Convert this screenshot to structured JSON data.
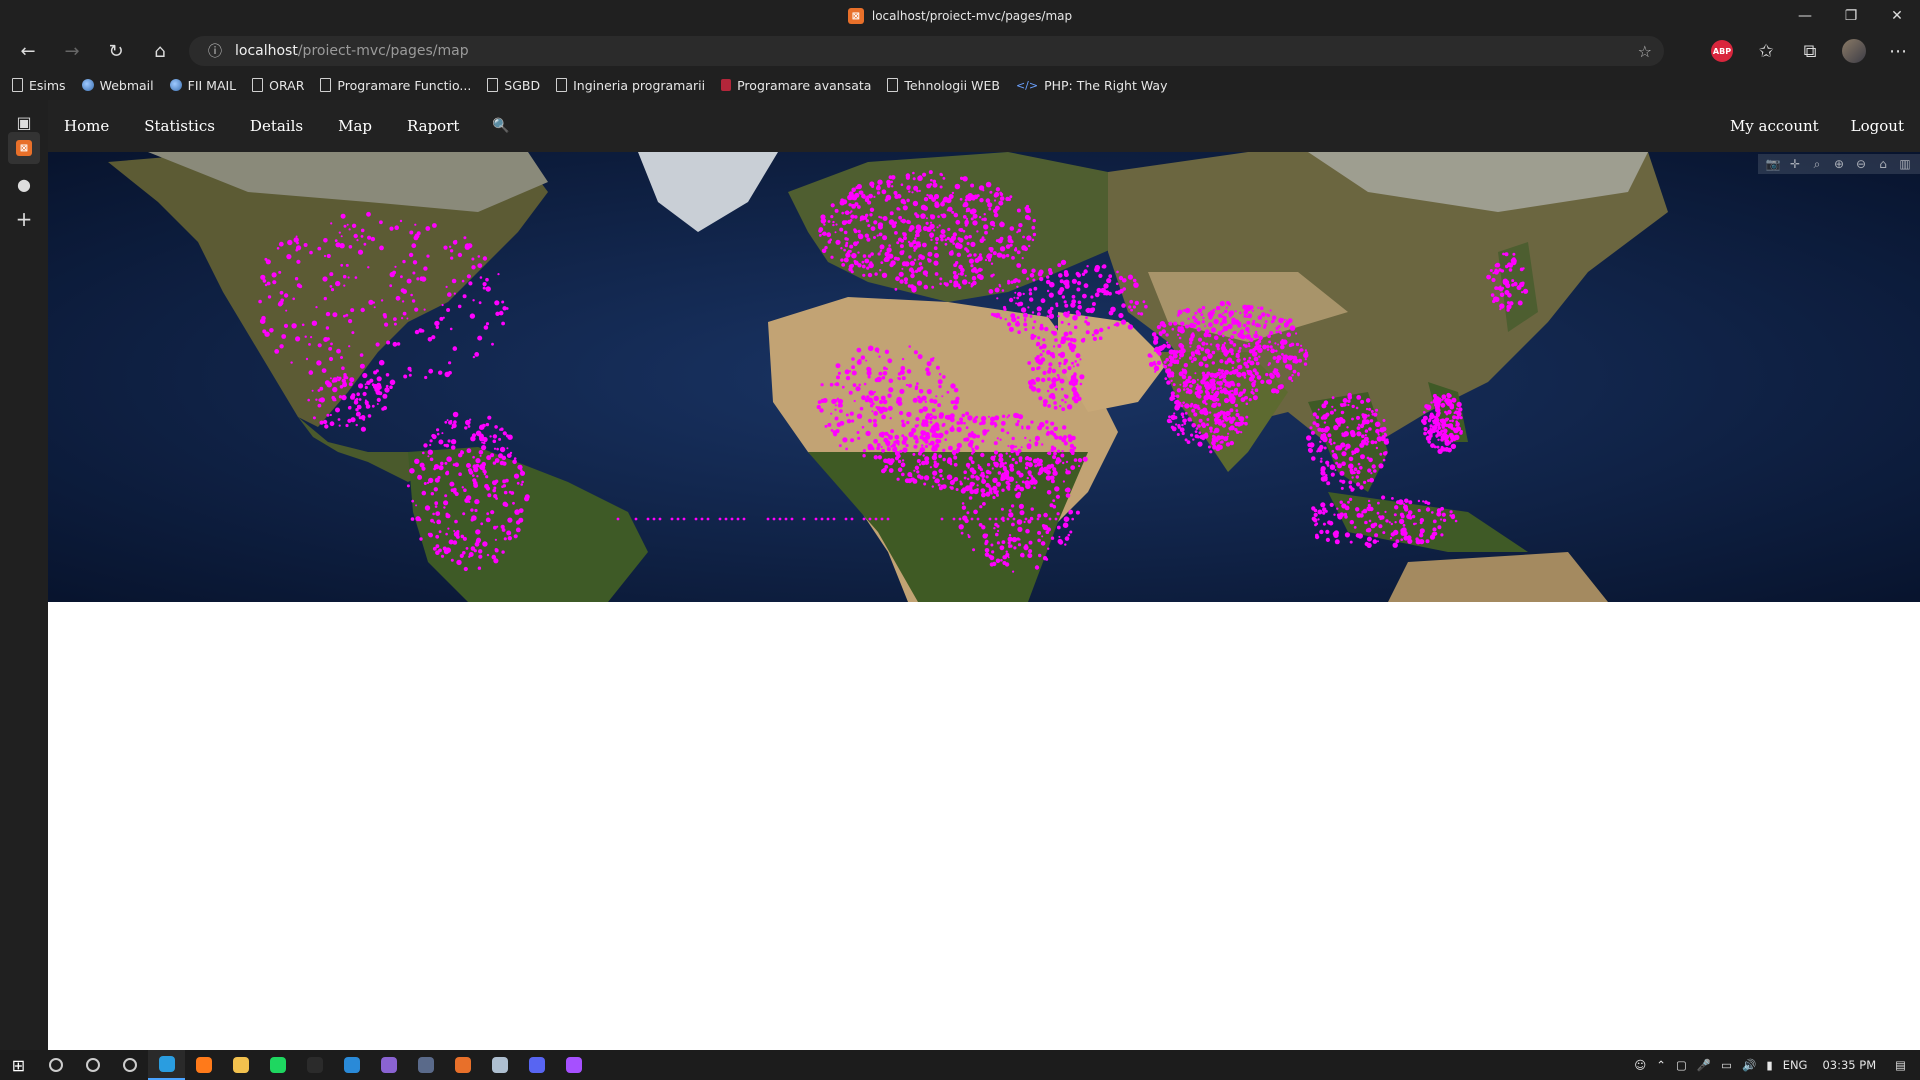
{
  "window": {
    "title": "localhost/proiect-mvc/pages/map",
    "controls": {
      "minimize": "—",
      "restore": "❐",
      "close": "✕"
    }
  },
  "toolbar": {
    "back_icon": "back-arrow-icon",
    "forward_icon": "forward-arrow-icon",
    "refresh_icon": "refresh-icon",
    "home_icon": "home-icon",
    "address": {
      "host": "localhost",
      "path": "/proiect-mvc/pages/map"
    },
    "abp_label": "ABP"
  },
  "bookmarks": [
    {
      "label": "Esims",
      "icon": "page"
    },
    {
      "label": "Webmail",
      "icon": "globe"
    },
    {
      "label": "FII MAIL",
      "icon": "globe"
    },
    {
      "label": "ORAR",
      "icon": "page"
    },
    {
      "label": "Programare Functio...",
      "icon": "page"
    },
    {
      "label": "SGBD",
      "icon": "page"
    },
    {
      "label": "Ingineria programarii",
      "icon": "page"
    },
    {
      "label": "Programare avansata",
      "icon": "red"
    },
    {
      "label": "Tehnologii WEB",
      "icon": "page"
    },
    {
      "label": "PHP: The Right Way",
      "icon": "code"
    }
  ],
  "site_nav": {
    "left": [
      "Home",
      "Statistics",
      "Details",
      "Map",
      "Raport"
    ],
    "search_icon": "🔍",
    "right": [
      "My account",
      "Logout"
    ]
  },
  "map": {
    "marker_color": "#ff00ff",
    "modebar": [
      "📷",
      "✛",
      "⌕",
      "⊕",
      "⊖",
      "⌂",
      "▥"
    ]
  },
  "taskbar": {
    "apps": [
      {
        "name": "search",
        "color": "#cccccc"
      },
      {
        "name": "cortana",
        "color": "#cccccc"
      },
      {
        "name": "task-view",
        "color": "#cccccc"
      },
      {
        "name": "edge",
        "color": "#2a9de0"
      },
      {
        "name": "firefox",
        "color": "#ff7a1a"
      },
      {
        "name": "file-explorer",
        "color": "#f2c14e"
      },
      {
        "name": "spotify",
        "color": "#1ed760"
      },
      {
        "name": "intellij",
        "color": "#2b2b2b"
      },
      {
        "name": "vscode",
        "color": "#2a8ad8"
      },
      {
        "name": "github-desktop",
        "color": "#8a63d2"
      },
      {
        "name": "terminal",
        "color": "#5a6a8a"
      },
      {
        "name": "xampp",
        "color": "#e8702a"
      },
      {
        "name": "steam",
        "color": "#aebfd0"
      },
      {
        "name": "discord",
        "color": "#5865f2"
      },
      {
        "name": "messenger",
        "color": "#a650ff"
      }
    ],
    "tray": {
      "lang": "ENG",
      "time": "03:35 PM"
    }
  }
}
